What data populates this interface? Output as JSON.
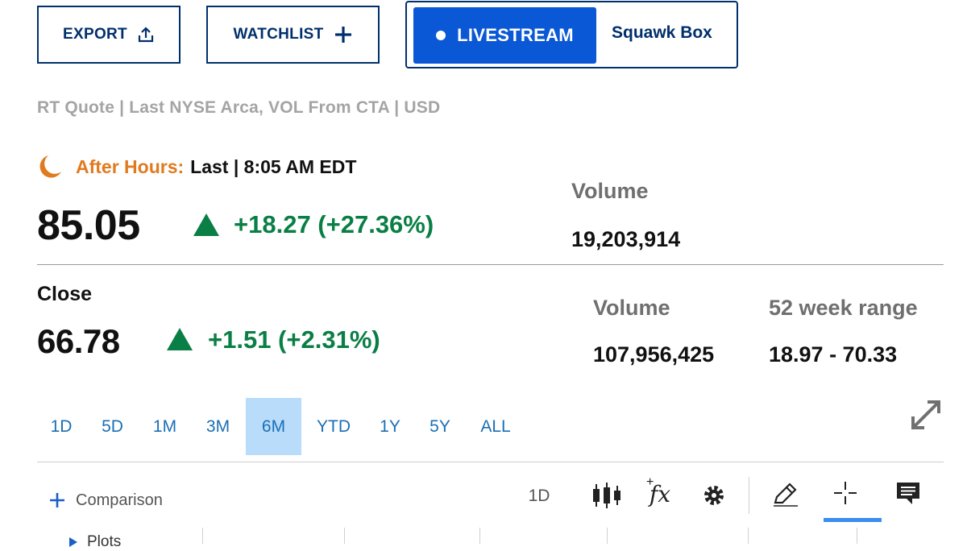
{
  "toolbar": {
    "export_label": "EXPORT",
    "watchlist_label": "WATCHLIST",
    "livestream_label": "LIVESTREAM",
    "show_name": "Squawk Box"
  },
  "quote_meta": "RT Quote | Last NYSE Arca, VOL From CTA | USD",
  "after_hours": {
    "label": "After Hours:",
    "last_time": "Last | 8:05 AM EDT",
    "price": "85.05",
    "change": "+18.27 (+27.36%)",
    "volume_label": "Volume",
    "volume": "19,203,914"
  },
  "close": {
    "label": "Close",
    "price": "66.78",
    "change": "+1.51 (+2.31%)",
    "volume_label": "Volume",
    "volume": "107,956,425",
    "range_label": "52 week range",
    "range": "18.97 - 70.33"
  },
  "ranges": [
    "1D",
    "5D",
    "1M",
    "3M",
    "6M",
    "YTD",
    "1Y",
    "5Y",
    "ALL"
  ],
  "active_range": "6M",
  "chart_toolbar": {
    "comparison_label": "Comparison",
    "interval": "1D",
    "fx_label": "fx",
    "plots_label": "Plots"
  },
  "colors": {
    "brand_navy": "#002f6c",
    "live_blue": "#0a58d6",
    "positive_green": "#0a7f45",
    "after_hours_orange": "#e07a1f",
    "active_range_bg": "#b9dcfb"
  }
}
